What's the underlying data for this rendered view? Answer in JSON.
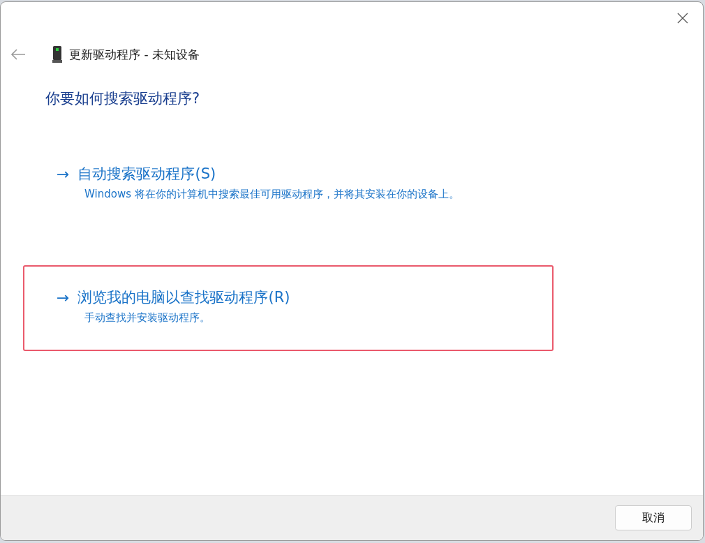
{
  "window": {
    "title": "更新驱动程序 - 未知设备"
  },
  "heading": "你要如何搜索驱动程序?",
  "options": [
    {
      "arrow": "→",
      "title": "自动搜索驱动程序(S)",
      "description": "Windows 将在你的计算机中搜索最佳可用驱动程序，并将其安装在你的设备上。",
      "highlighted": false
    },
    {
      "arrow": "→",
      "title": "浏览我的电脑以查找驱动程序(R)",
      "description": "手动查找并安装驱动程序。",
      "highlighted": true
    }
  ],
  "buttons": [
    "取消"
  ]
}
